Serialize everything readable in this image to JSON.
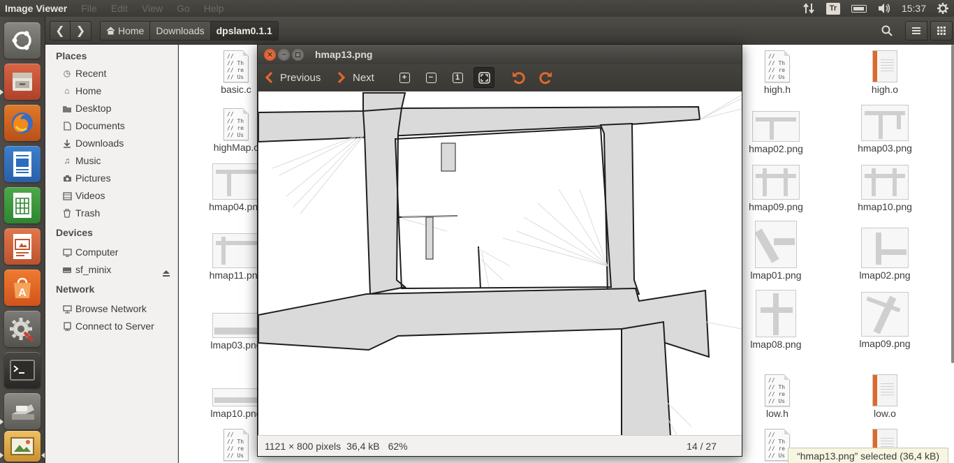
{
  "top_panel": {
    "app_name": "Image Viewer",
    "menus": [
      "File",
      "Edit",
      "View",
      "Go",
      "Help"
    ],
    "keyboard_indicator": "Tr",
    "clock": "15:37",
    "icons": [
      "network-arrows-icon",
      "keyboard-layout-icon",
      "battery-icon",
      "volume-icon",
      "gear-icon"
    ]
  },
  "launcher": {
    "items": [
      "ubuntu-dash",
      "files",
      "firefox",
      "libreoffice-writer",
      "libreoffice-calc",
      "libreoffice-impress",
      "software-center",
      "system-settings",
      "terminal",
      "scanner",
      "image-viewer"
    ]
  },
  "files": {
    "breadcrumbs": [
      "Home",
      "Downloads",
      "dpslam0.1.1"
    ],
    "sidebar": {
      "places_header": "Places",
      "places": [
        "Recent",
        "Home",
        "Desktop",
        "Documents",
        "Downloads",
        "Music",
        "Pictures",
        "Videos",
        "Trash"
      ],
      "devices_header": "Devices",
      "devices": [
        "Computer",
        "sf_minix"
      ],
      "network_header": "Network",
      "network": [
        "Browse Network",
        "Connect to Server"
      ]
    },
    "grid_left": [
      "basic.c",
      "highMap.c",
      "hmap04.png",
      "hmap11.png",
      "lmap03.png",
      "lmap10.png"
    ],
    "grid_right": [
      [
        "high.h",
        "high.o"
      ],
      [
        "hmap02.png",
        "hmap03.png"
      ],
      [
        "hmap09.png",
        "hmap10.png"
      ],
      [
        "lmap01.png",
        "lmap02.png"
      ],
      [
        "lmap08.png",
        "lmap09.png"
      ],
      [
        "low.h",
        "low.o"
      ]
    ],
    "text_icon_lines": [
      "//",
      "// Th",
      "// re",
      "// Us"
    ],
    "status_selection": "“hmap13.png” selected (36,4 kB)"
  },
  "viewer": {
    "title": "hmap13.png",
    "previous_label": "Previous",
    "next_label": "Next",
    "zoom_in_symbol": "+",
    "zoom_out_symbol": "−",
    "normal_size_symbol": "1",
    "status_dimensions": "1121 × 800 pixels",
    "status_size": "36,4 kB",
    "status_zoom": "62%",
    "status_index": "14 / 27"
  },
  "colors": {
    "panel": "#3c3b37",
    "close_button": "#e05a2b",
    "rotate_arrow": "#e0692a",
    "map_gray": "#d9d9d9",
    "map_wall": "#1e1e1e"
  }
}
